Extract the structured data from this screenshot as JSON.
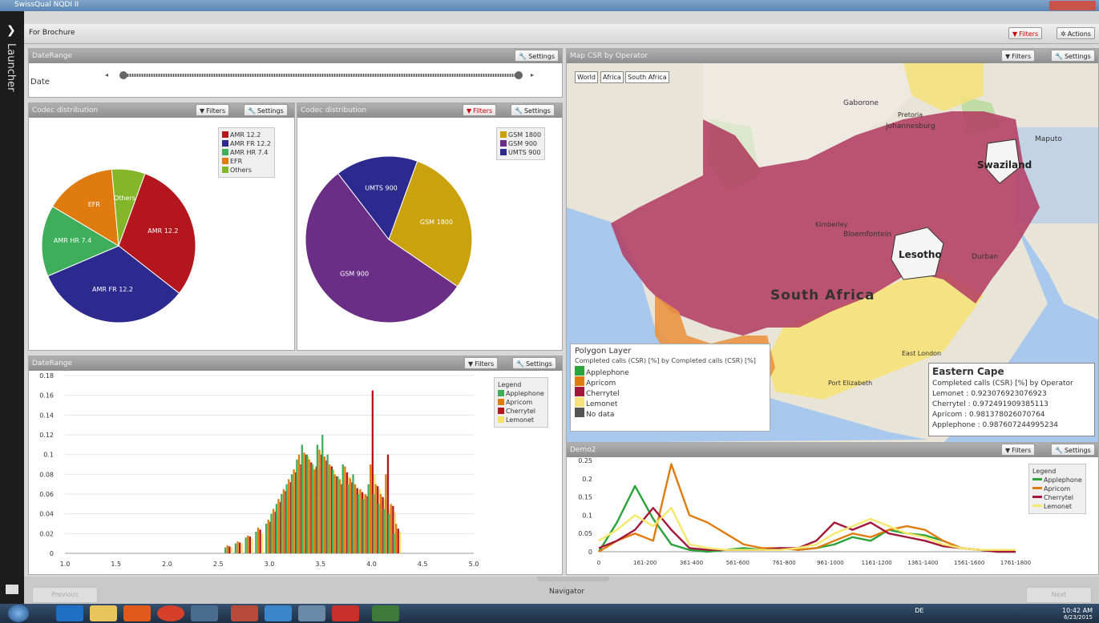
{
  "window": {
    "title": "SwissQual NQDI II"
  },
  "launcher": {
    "label": "Launcher"
  },
  "toolbar": {
    "name": "For Brochure",
    "filters": "Filters",
    "actions": "Actions"
  },
  "common": {
    "filters": "Filters",
    "settings": "Settings"
  },
  "daterange_panel": {
    "title": "DateRange",
    "date_label": "Date",
    "prev": "◂",
    "next": "▸"
  },
  "codec_left": {
    "title": "Codec distribution",
    "chart_data": {
      "type": "pie",
      "labels": [
        "AMR 12.2",
        "AMR FR 12.2",
        "AMR HR 7.4",
        "EFR",
        "Others"
      ],
      "values": [
        30,
        33,
        15,
        15,
        7
      ],
      "colors": [
        "#b3171d",
        "#2d2a8f",
        "#3fae5b",
        "#e07b10",
        "#84b629"
      ]
    }
  },
  "codec_right": {
    "title": "Codec distribution",
    "chart_data": {
      "type": "pie",
      "labels": [
        "GSM 1800",
        "GSM 900",
        "UMTS 900"
      ],
      "values": [
        29,
        55,
        16
      ],
      "colors": [
        "#c9a20e",
        "#6b2e86",
        "#2d2a8f"
      ]
    }
  },
  "daterange_chart": {
    "title": "DateRange",
    "legend_title": "Legend",
    "chart_data": {
      "type": "bar",
      "xlim": [
        1.0,
        5.0
      ],
      "ylim": [
        0,
        0.18
      ],
      "x_ticks": [
        "1.0",
        "1.5",
        "2.0",
        "2.5",
        "3.0",
        "3.5",
        "4.0",
        "4.5",
        "5.0"
      ],
      "y_ticks": [
        "0",
        "0.02",
        "0.04",
        "0.06",
        "0.08",
        "0.1",
        "0.12",
        "0.14",
        "0.16",
        "0.18"
      ],
      "x": [
        2.6,
        2.7,
        2.8,
        2.9,
        3.0,
        3.05,
        3.1,
        3.15,
        3.2,
        3.25,
        3.3,
        3.35,
        3.4,
        3.45,
        3.5,
        3.55,
        3.6,
        3.65,
        3.7,
        3.75,
        3.8,
        3.85,
        3.9,
        3.95,
        4.0,
        4.05,
        4.1,
        4.15,
        4.2,
        4.25
      ],
      "series": [
        {
          "name": "Applephone",
          "color": "#3fae5b",
          "values": [
            0.006,
            0.01,
            0.016,
            0.022,
            0.03,
            0.04,
            0.05,
            0.06,
            0.07,
            0.08,
            0.095,
            0.11,
            0.1,
            0.09,
            0.11,
            0.12,
            0.1,
            0.085,
            0.078,
            0.09,
            0.07,
            0.08,
            0.06,
            0.055,
            0.07,
            0.06,
            0.05,
            0.045,
            0.04,
            0.02
          ]
        },
        {
          "name": "Apricom",
          "color": "#e07b10",
          "values": [
            0.008,
            0.012,
            0.018,
            0.026,
            0.034,
            0.045,
            0.055,
            0.065,
            0.075,
            0.085,
            0.1,
            0.102,
            0.095,
            0.085,
            0.105,
            0.098,
            0.09,
            0.08,
            0.075,
            0.088,
            0.076,
            0.07,
            0.065,
            0.06,
            0.09,
            0.07,
            0.06,
            0.08,
            0.05,
            0.03
          ]
        },
        {
          "name": "Cherrytel",
          "color": "#b3171d",
          "values": [
            0.007,
            0.011,
            0.017,
            0.024,
            0.032,
            0.042,
            0.052,
            0.063,
            0.072,
            0.082,
            0.09,
            0.1,
            0.092,
            0.088,
            0.1,
            0.094,
            0.088,
            0.078,
            0.07,
            0.082,
            0.072,
            0.066,
            0.062,
            0.058,
            0.165,
            0.068,
            0.057,
            0.1,
            0.048,
            0.025
          ]
        },
        {
          "name": "Lemonet",
          "color": "#f4e36a",
          "values": [
            0.006,
            0.01,
            0.015,
            0.02,
            0.028,
            0.038,
            0.048,
            0.058,
            0.068,
            0.078,
            0.088,
            0.098,
            0.09,
            0.085,
            0.098,
            0.09,
            0.084,
            0.075,
            0.068,
            0.078,
            0.07,
            0.064,
            0.06,
            0.056,
            0.08,
            0.065,
            0.055,
            0.045,
            0.042,
            0.022
          ]
        }
      ]
    }
  },
  "map_panel": {
    "title": "Map CSR by Operator",
    "buttons": [
      "World",
      "Africa",
      "South Africa"
    ],
    "labels": {
      "sa": "South Africa",
      "lesotho": "Lesotho",
      "swaziland": "Swaziland",
      "gaborone": "Gaborone",
      "maputo": "Maputo",
      "bloemfontein": "Bloemfontein",
      "durban": "Durban",
      "kimberley": "Kimberley",
      "pe": "Port Elizabeth",
      "pretoria": "Pretoria",
      "jhb": "Johannesburg",
      "el": "East London"
    },
    "polygon_legend": {
      "title": "Polygon Layer",
      "subtitle": "Completed calls (CSR) [%] by Completed calls (CSR) [%]",
      "items": [
        {
          "label": "Applephone",
          "color": "#2aa33b"
        },
        {
          "label": "Apricom",
          "color": "#e07b10"
        },
        {
          "label": "Cherrytel",
          "color": "#a3173a"
        },
        {
          "label": "Lemonet",
          "color": "#f6e27a"
        },
        {
          "label": "No data",
          "color": "#555555"
        }
      ]
    },
    "info": {
      "title": "Eastern Cape",
      "subtitle": "Completed calls (CSR) [%] by Operator",
      "rows": [
        "Lemonet : 0.923076923076923",
        "Cherrytel : 0.972491909385113",
        "Apricom : 0.981378026070764",
        "Applephone : 0.987607244995234"
      ]
    }
  },
  "demo2": {
    "title": "Demo2",
    "legend_title": "Legend",
    "chart_data": {
      "type": "line",
      "ylim": [
        0,
        0.25
      ],
      "y_ticks": [
        "0",
        "0.05",
        "0.1",
        "0.15",
        "0.2",
        "0.25"
      ],
      "categories": [
        "0",
        "161-200",
        "361-400",
        "561-600",
        "761-800",
        "961-1000",
        "1161-1200",
        "1361-1400",
        "1561-1600",
        "1761-1800"
      ],
      "series": [
        {
          "name": "Applephone",
          "color": "#2aa33b",
          "values": [
            0.0,
            0.08,
            0.18,
            0.09,
            0.02,
            0.005,
            0.0,
            0.005,
            0.01,
            0.005,
            0.01,
            0.005,
            0.01,
            0.02,
            0.04,
            0.03,
            0.06,
            0.05,
            0.045,
            0.03,
            0.01,
            0.005,
            0.0,
            0.0
          ]
        },
        {
          "name": "Apricom",
          "color": "#e07b10",
          "values": [
            0.0,
            0.03,
            0.05,
            0.03,
            0.24,
            0.1,
            0.08,
            0.05,
            0.02,
            0.01,
            0.01,
            0.005,
            0.01,
            0.03,
            0.05,
            0.04,
            0.06,
            0.07,
            0.06,
            0.03,
            0.01,
            0.005,
            0.005,
            0.005
          ]
        },
        {
          "name": "Cherrytel",
          "color": "#a3173a",
          "values": [
            0.01,
            0.03,
            0.06,
            0.12,
            0.06,
            0.01,
            0.005,
            0.005,
            0.005,
            0.005,
            0.01,
            0.01,
            0.03,
            0.08,
            0.06,
            0.08,
            0.05,
            0.04,
            0.03,
            0.015,
            0.01,
            0.005,
            0.0,
            0.0
          ]
        },
        {
          "name": "Lemonet",
          "color": "#f6e86a",
          "values": [
            0.03,
            0.06,
            0.1,
            0.07,
            0.12,
            0.02,
            0.01,
            0.005,
            0.005,
            0.005,
            0.005,
            0.01,
            0.02,
            0.05,
            0.07,
            0.09,
            0.07,
            0.05,
            0.04,
            0.02,
            0.01,
            0.005,
            0.005,
            0.005
          ]
        }
      ]
    }
  },
  "navigator": {
    "label": "Navigator",
    "previous": "Previous",
    "next": "Next"
  },
  "taskbar": {
    "lang": "DE",
    "time": "10:42 AM",
    "date": "6/23/2015"
  }
}
